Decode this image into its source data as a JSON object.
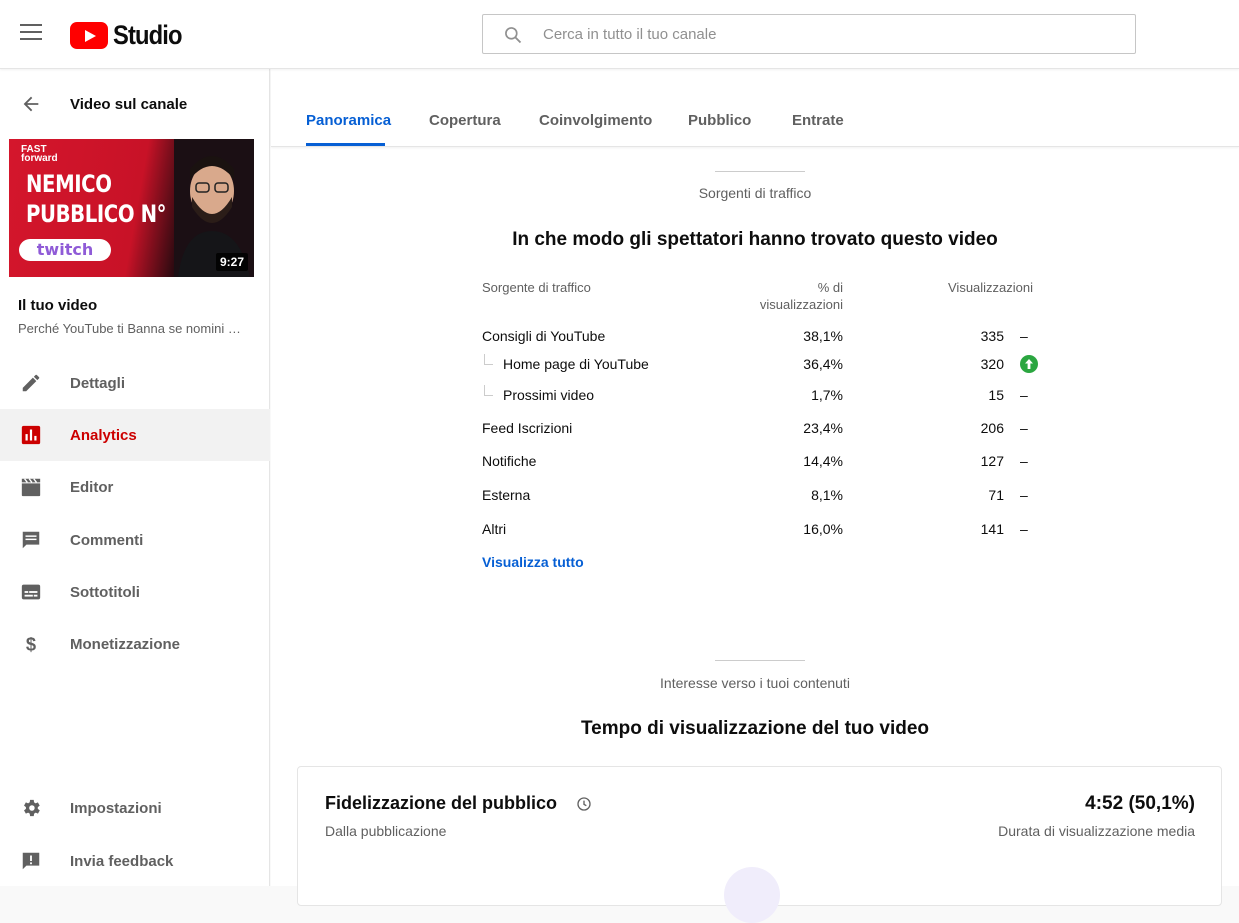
{
  "header": {
    "logo_text": "Studio",
    "search_placeholder": "Cerca in tutto il tuo canale"
  },
  "sidebar": {
    "back_label": "Video sul canale",
    "thumbnail": {
      "brand_line1": "FAST",
      "brand_line2": "forward",
      "title_line1": "NEMICO",
      "title_line2": "PUBBLICO N° 1?",
      "badge": "twitch",
      "duration": "9:27"
    },
    "your_video_label": "Il tuo video",
    "video_title": "Perché YouTube ti Banna se nomini …",
    "nav": [
      {
        "label": "Dettagli",
        "icon": "pencil-icon",
        "active": false
      },
      {
        "label": "Analytics",
        "icon": "analytics-icon",
        "active": true
      },
      {
        "label": "Editor",
        "icon": "clapperboard-icon",
        "active": false
      },
      {
        "label": "Commenti",
        "icon": "comment-icon",
        "active": false
      },
      {
        "label": "Sottotitoli",
        "icon": "subtitles-icon",
        "active": false
      },
      {
        "label": "Monetizzazione",
        "icon": "dollar-icon",
        "active": false
      }
    ],
    "bottom_nav": [
      {
        "label": "Impostazioni",
        "icon": "gear-icon"
      },
      {
        "label": "Invia feedback",
        "icon": "feedback-icon"
      }
    ]
  },
  "tabs": [
    {
      "label": "Panoramica",
      "active": true
    },
    {
      "label": "Copertura",
      "active": false
    },
    {
      "label": "Coinvolgimento",
      "active": false
    },
    {
      "label": "Pubblico",
      "active": false
    },
    {
      "label": "Entrate",
      "active": false
    }
  ],
  "traffic": {
    "section_label": "Sorgenti di traffico",
    "title": "In che modo gli spettatori hanno trovato questo video",
    "col_source": "Sorgente di traffico",
    "col_pct_line1": "% di",
    "col_pct_line2": "visualizzazioni",
    "col_views": "Visualizzazioni",
    "rows": [
      {
        "source": "Consigli di YouTube",
        "pct": "38,1%",
        "views": "335",
        "trend": "–",
        "sub": false
      },
      {
        "source": "Home page di YouTube",
        "pct": "36,4%",
        "views": "320",
        "trend": "up",
        "sub": true
      },
      {
        "source": "Prossimi video",
        "pct": "1,7%",
        "views": "15",
        "trend": "–",
        "sub": true
      },
      {
        "source": "Feed Iscrizioni",
        "pct": "23,4%",
        "views": "206",
        "trend": "–",
        "sub": false
      },
      {
        "source": "Notifiche",
        "pct": "14,4%",
        "views": "127",
        "trend": "–",
        "sub": false
      },
      {
        "source": "Esterna",
        "pct": "8,1%",
        "views": "71",
        "trend": "–",
        "sub": false
      },
      {
        "source": "Altri",
        "pct": "16,0%",
        "views": "141",
        "trend": "–",
        "sub": false
      }
    ],
    "view_all": "Visualizza tutto"
  },
  "interest": {
    "section_label": "Interesse verso i tuoi contenuti",
    "title": "Tempo di visualizzazione del tuo video"
  },
  "retention_card": {
    "title": "Fidelizzazione del pubblico",
    "subtitle": "Dalla pubblicazione",
    "value": "4:52 (50,1%)",
    "value_label": "Durata di visualizzazione media"
  },
  "colors": {
    "accent_blue": "#065fd4",
    "brand_red": "#ff0000",
    "active_nav_red": "#cc0000",
    "trend_up_green": "#2ba640"
  }
}
